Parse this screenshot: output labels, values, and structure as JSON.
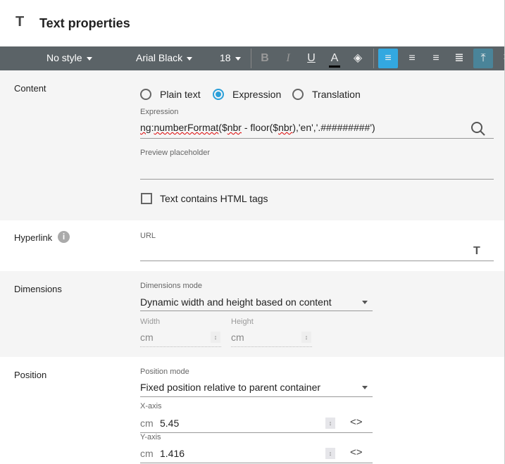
{
  "dialog": {
    "title": "Text properties",
    "title_icon": "text-T-icon"
  },
  "toolbar": {
    "style": "No style",
    "font": "Arial Black",
    "size": "18",
    "buttons": [
      "bold",
      "italic",
      "underline",
      "font-color",
      "fill-color",
      "align-left",
      "align-center",
      "align-right",
      "align-justify",
      "valign-top"
    ],
    "font_color": "#000000",
    "active_color": "#33a8e0"
  },
  "content": {
    "label": "Content",
    "radios": [
      {
        "label": "Plain text",
        "selected": false
      },
      {
        "label": "Expression",
        "selected": true
      },
      {
        "label": "Translation",
        "selected": false
      }
    ],
    "expression_label": "Expression",
    "expression_parts": [
      "ng",
      "numberFormat",
      "($",
      "nbr",
      " - floor($",
      "nbr",
      "),'en','.#########')"
    ],
    "preview_label": "Preview placeholder",
    "preview_value": "",
    "html_checkbox": {
      "label": "Text contains HTML tags",
      "checked": false
    }
  },
  "hyperlink": {
    "label": "Hyperlink",
    "url_label": "URL",
    "url_value": ""
  },
  "dimensions": {
    "label": "Dimensions",
    "mode_label": "Dimensions mode",
    "mode_value": "Dynamic width and height based on content",
    "width_label": "Width",
    "width_unit": "cm",
    "height_label": "Height",
    "height_unit": "cm"
  },
  "position": {
    "label": "Position",
    "mode_label": "Position mode",
    "mode_value": "Fixed position relative to parent container",
    "x_label": "X-axis",
    "x_unit": "cm",
    "x_value": "5.45",
    "y_label": "Y-axis",
    "y_unit": "cm",
    "y_value": "1.416"
  }
}
